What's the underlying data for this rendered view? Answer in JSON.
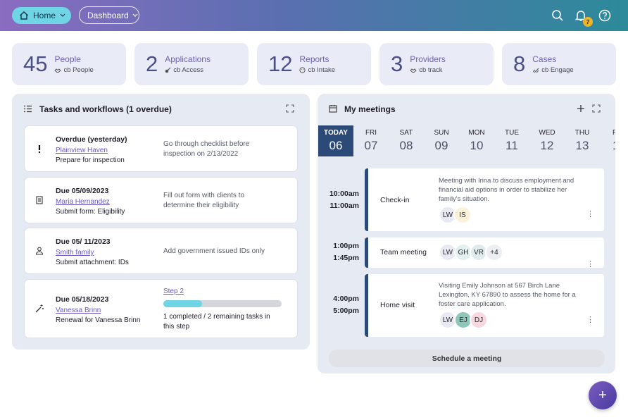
{
  "topbar": {
    "home_label": "Home",
    "dashboard_label": "Dashboard",
    "notifications_count": "7",
    "gradient_colors": [
      "#8a6cc0",
      "#5a6fb0",
      "#2c8a9a"
    ],
    "icons": [
      "home-icon",
      "chevron-down-icon",
      "search-icon",
      "bell-icon",
      "help-icon"
    ]
  },
  "stats": [
    {
      "number": "45",
      "name": "People",
      "sub": "cb People",
      "icon": "handshake-icon"
    },
    {
      "number": "2",
      "name": "Applications",
      "sub": "cb Access",
      "icon": "key-icon"
    },
    {
      "number": "12",
      "name": "Reports",
      "sub": "cb Intake",
      "icon": "face-icon"
    },
    {
      "number": "3",
      "name": "Providers",
      "sub": "cb track",
      "icon": "handshake-icon"
    },
    {
      "number": "8",
      "name": "Cases",
      "sub": "cb Engage",
      "icon": "link-icon"
    }
  ],
  "tasks": {
    "title": "Tasks and workflows (1 overdue)",
    "items": [
      {
        "icon": "exclamation-icon",
        "due": "Overdue (yesterday)",
        "who": "Plainview Haven",
        "what": "Prepare for inspection",
        "desc": "Go through checklist before inspection on 2/13/2022"
      },
      {
        "icon": "document-icon",
        "due": "Due 05/09/2023",
        "who": "Maria Hernandez",
        "what": "Submit form: Eligibility",
        "desc": "Fill out form with clients to determine their eligibility"
      },
      {
        "icon": "upload-person-icon",
        "due": "Due 05/ 11/2023",
        "who": "Smith family",
        "what": "Submit attachment: IDs",
        "desc": "Add government issued IDs only"
      },
      {
        "icon": "wand-icon",
        "due": "Due 05/18/2023",
        "who": "Vanessa Brinn",
        "what": "Renewal for Vanessa Brinn",
        "step": "Step 2",
        "progress": 0.33,
        "desc": "1 completed / 2 remaining tasks in this step"
      }
    ]
  },
  "meetings": {
    "title": "My meetings",
    "days": [
      {
        "name": "TODAY",
        "date": "06"
      },
      {
        "name": "FRI",
        "date": "07"
      },
      {
        "name": "SAT",
        "date": "08"
      },
      {
        "name": "SUN",
        "date": "09"
      },
      {
        "name": "MON",
        "date": "10"
      },
      {
        "name": "TUE",
        "date": "11"
      },
      {
        "name": "WED",
        "date": "12"
      },
      {
        "name": "THU",
        "date": "13"
      },
      {
        "name": "F",
        "date": "1"
      }
    ],
    "items": [
      {
        "start": "10:00am",
        "end": "11:00am",
        "title": "Check-in",
        "desc": "Meeting with Irina to discuss employment and financial aid options in order to stabilize her family's situation.",
        "attendees": [
          "LW",
          "IS"
        ]
      },
      {
        "start": "1:00pm",
        "end": "1:45pm",
        "title": "Team meeting",
        "desc": "",
        "attendees": [
          "LW",
          "GH",
          "VR",
          "+4"
        ]
      },
      {
        "start": "4:00pm",
        "end": "5:00pm",
        "title": "Home visit",
        "desc": "Visiting Emily Johnson at 567 Birch Lane Lexington, KY 67890 to assess the home for a foster care application.",
        "attendees": [
          "LW",
          "EJ",
          "DJ"
        ]
      }
    ],
    "schedule_label": "Schedule a meeting"
  },
  "fab_label": "+",
  "colors": {
    "accent": "#6a59c0",
    "today": "#2c4a78",
    "progress": "#6fd4e4"
  }
}
